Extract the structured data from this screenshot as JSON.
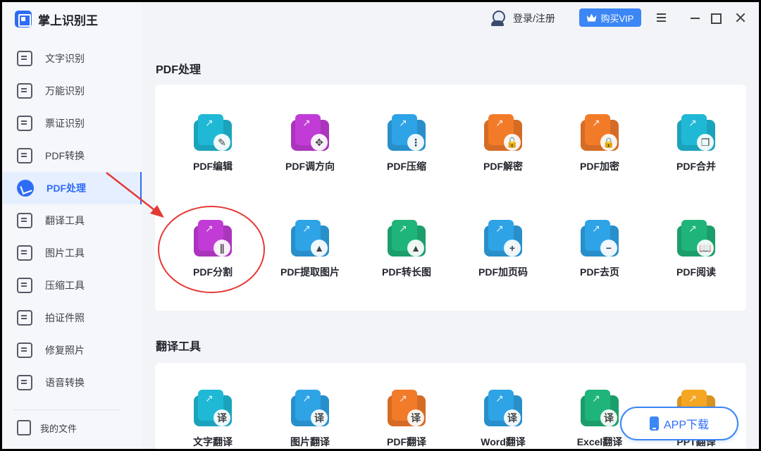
{
  "app": {
    "title": "掌上识别王"
  },
  "header": {
    "login_label": "登录/注册",
    "vip_label": "购买VIP"
  },
  "sidebar": {
    "items": [
      {
        "label": "文字识别",
        "icon": "text-recognize-icon",
        "active": false
      },
      {
        "label": "万能识别",
        "icon": "universal-recognize-icon",
        "active": false
      },
      {
        "label": "票证识别",
        "icon": "ticket-recognize-icon",
        "active": false
      },
      {
        "label": "PDF转换",
        "icon": "pdf-convert-icon",
        "active": false
      },
      {
        "label": "PDF处理",
        "icon": "pdf-process-icon",
        "active": true
      },
      {
        "label": "翻译工具",
        "icon": "translate-icon",
        "active": false
      },
      {
        "label": "图片工具",
        "icon": "image-tool-icon",
        "active": false
      },
      {
        "label": "压缩工具",
        "icon": "compress-icon",
        "active": false
      },
      {
        "label": "拍证件照",
        "icon": "id-photo-icon",
        "active": false
      },
      {
        "label": "修复照片",
        "icon": "photo-repair-icon",
        "active": false
      },
      {
        "label": "语音转换",
        "icon": "voice-convert-icon",
        "active": false
      }
    ],
    "my_files": "我的文件"
  },
  "sections": [
    {
      "title": "PDF处理",
      "tools": [
        {
          "label": "PDF编辑",
          "icon": "pdf-edit-icon",
          "color": "#1fb9d6",
          "badge": "✎"
        },
        {
          "label": "PDF调方向",
          "icon": "pdf-rotate-icon",
          "color": "#c13cd6",
          "badge": "✥"
        },
        {
          "label": "PDF压缩",
          "icon": "pdf-compress-icon",
          "color": "#2ea3e6",
          "badge": "⋮"
        },
        {
          "label": "PDF解密",
          "icon": "pdf-decrypt-icon",
          "color": "#f27b2a",
          "badge": "🔓"
        },
        {
          "label": "PDF加密",
          "icon": "pdf-encrypt-icon",
          "color": "#f27b2a",
          "badge": "🔒"
        },
        {
          "label": "PDF合并",
          "icon": "pdf-merge-icon",
          "color": "#1fb9d6",
          "badge": "❐"
        },
        {
          "label": "PDF分割",
          "icon": "pdf-split-icon",
          "color": "#c13cd6",
          "badge": "∥"
        },
        {
          "label": "PDF提取图片",
          "icon": "pdf-extract-image-icon",
          "color": "#2ea3e6",
          "badge": "▲"
        },
        {
          "label": "PDF转长图",
          "icon": "pdf-long-image-icon",
          "color": "#1fb47a",
          "badge": "▲"
        },
        {
          "label": "PDF加页码",
          "icon": "pdf-add-page-number-icon",
          "color": "#2ea3e6",
          "badge": "+"
        },
        {
          "label": "PDF去页",
          "icon": "pdf-remove-page-icon",
          "color": "#2ea3e6",
          "badge": "−"
        },
        {
          "label": "PDF阅读",
          "icon": "pdf-read-icon",
          "color": "#1fb47a",
          "badge": "📖"
        }
      ]
    },
    {
      "title": "翻译工具",
      "tools": [
        {
          "label": "文字翻译",
          "icon": "text-translate-icon",
          "color": "#1fb9d6",
          "badge": "译"
        },
        {
          "label": "图片翻译",
          "icon": "image-translate-icon",
          "color": "#2ea3e6",
          "badge": "译"
        },
        {
          "label": "PDF翻译",
          "icon": "pdf-translate-icon",
          "color": "#f27b2a",
          "badge": "译"
        },
        {
          "label": "Word翻译",
          "icon": "word-translate-icon",
          "color": "#2ea3e6",
          "badge": "译"
        },
        {
          "label": "Excel翻译",
          "icon": "excel-translate-icon",
          "color": "#1fb47a",
          "badge": "译"
        },
        {
          "label": "PPT翻译",
          "icon": "ppt-translate-icon",
          "color": "#f5a623",
          "badge": "译"
        }
      ]
    }
  ],
  "app_download": {
    "label": "APP下载"
  }
}
